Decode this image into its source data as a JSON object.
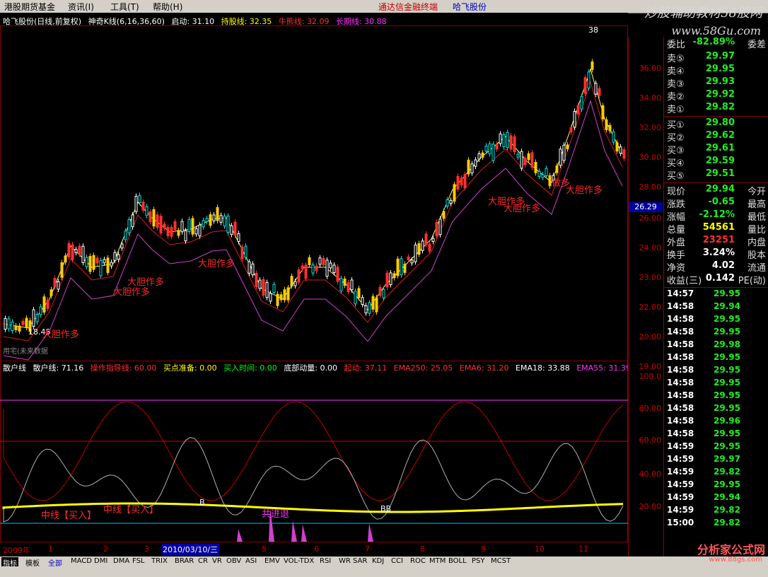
{
  "menu": {
    "items": [
      "港股期货基金",
      "资讯(I)",
      "工具(T)",
      "帮助(H)"
    ],
    "center": "通达信金融终端",
    "stock": "哈飞股份",
    "watermark": "炒股辅助教材58股网",
    "watermark_url": "www.58Gu.com"
  },
  "main_chart": {
    "info": [
      {
        "text": "哈飞股份(日线,前复权)",
        "color": "#ffffff"
      },
      {
        "text": "神奇K线(6,16,36,60)",
        "color": "#ffffff"
      },
      {
        "text": "启动: 31.10",
        "color": "#ffffff"
      },
      {
        "text": "持股线: 32.35",
        "color": "#ffff00"
      },
      {
        "text": "牛熊线: 32.09",
        "color": "#ff3030"
      },
      {
        "text": "长期线: 30.88",
        "color": "#ff30ff"
      }
    ],
    "peak_label": "38",
    "low_label": "18.45",
    "footer_text": "用宅(未来数据",
    "annotations": [
      "大胆作多",
      "大胆作多",
      "大胆作多",
      "大胆作多",
      "大胆作多",
      "大胆作多",
      "做多",
      "大胆作多"
    ],
    "y_axis": [
      "36.00",
      "34.00",
      "32.00",
      "30.00",
      "28.00",
      "26.00",
      "24.00",
      "23.00",
      "22.00",
      "20.00",
      "19.00"
    ],
    "y_highlight": "26.29"
  },
  "indicator": {
    "info": [
      {
        "text": "散户线",
        "color": "#ffffff"
      },
      {
        "text": "散户线: 71.16",
        "color": "#ffffff"
      },
      {
        "text": "操作指导线: 60.00",
        "color": "#ff3030"
      },
      {
        "text": "买点准备: 0.00",
        "color": "#ffff00"
      },
      {
        "text": "买入时间: 0.00",
        "color": "#00ff00"
      },
      {
        "text": "底部动量: 0.00",
        "color": "#ffffff"
      },
      {
        "text": "起动: 37.11",
        "color": "#ff3030"
      },
      {
        "text": "EMA250: 25.05",
        "color": "#ff3030"
      },
      {
        "text": "EMA6: 31.20",
        "color": "#ff3030"
      },
      {
        "text": "EMA18: 33.88",
        "color": "#ffffff"
      },
      {
        "text": "EMA55: 31.39",
        "color": "#ff30ff"
      }
    ],
    "y_axis": [
      "100.0",
      "80.00",
      "60.00",
      "40.00",
      "20.00"
    ],
    "annotations": [
      "中线【买入】",
      "中线【买入】",
      "共进退",
      "B",
      "BB"
    ]
  },
  "date_axis": {
    "labels": [
      "2009年",
      "1",
      "2",
      "3",
      "5",
      "6",
      "7",
      "8",
      "9",
      "10",
      "11"
    ],
    "highlight": "2010/03/10/三"
  },
  "quote": {
    "sells": [
      {
        "label": "卖⑤",
        "value": "29.97"
      },
      {
        "label": "卖④",
        "value": "29.95"
      },
      {
        "label": "卖③",
        "value": "29.93"
      },
      {
        "label": "卖②",
        "value": "29.92"
      },
      {
        "label": "卖①",
        "value": "29.82"
      }
    ],
    "buys": [
      {
        "label": "买①",
        "value": "29.80"
      },
      {
        "label": "买②",
        "value": "29.62"
      },
      {
        "label": "买③",
        "value": "29.61"
      },
      {
        "label": "买④",
        "value": "29.59"
      },
      {
        "label": "买⑤",
        "value": "29.51"
      }
    ],
    "weibi": {
      "label": "委比",
      "value": "-82.89%",
      "ext": "委差"
    },
    "stats": [
      {
        "label": "现价",
        "value": "29.94",
        "ext": "今开",
        "color": "#1ef01e"
      },
      {
        "label": "涨跌",
        "value": "-0.65",
        "ext": "最高",
        "color": "#1ef01e"
      },
      {
        "label": "涨幅",
        "value": "-2.12%",
        "ext": "最低",
        "color": "#1ef01e"
      },
      {
        "label": "总量",
        "value": "54561",
        "ext": "量比",
        "color": "#ffff00"
      },
      {
        "label": "外盘",
        "value": "23251",
        "ext": "内盘",
        "color": "#ff3030"
      },
      {
        "label": "换手",
        "value": "3.24%",
        "ext": "股本",
        "color": "#ffffff"
      },
      {
        "label": "净资",
        "value": "4.02",
        "ext": "流通",
        "color": "#ffffff"
      },
      {
        "label": "收益(三)",
        "value": "0.142",
        "ext": "PE(动)",
        "color": "#ffffff"
      }
    ]
  },
  "ticks": [
    {
      "time": "14:57",
      "price": "29.95"
    },
    {
      "time": "14:58",
      "price": "29.94"
    },
    {
      "time": "14:58",
      "price": "29.95"
    },
    {
      "time": "14:58",
      "price": "29.95"
    },
    {
      "time": "14:58",
      "price": "29.98"
    },
    {
      "time": "14:58",
      "price": "29.95"
    },
    {
      "time": "14:58",
      "price": "29.95"
    },
    {
      "time": "14:58",
      "price": "29.95"
    },
    {
      "time": "14:58",
      "price": "29.95"
    },
    {
      "time": "14:58",
      "price": "29.95"
    },
    {
      "time": "14:58",
      "price": "29.96"
    },
    {
      "time": "14:58",
      "price": "29.95"
    },
    {
      "time": "14:59",
      "price": "29.95"
    },
    {
      "time": "14:59",
      "price": "29.97"
    },
    {
      "time": "14:59",
      "price": "29.82"
    },
    {
      "time": "14:59",
      "price": "29.95"
    },
    {
      "time": "14:59",
      "price": "29.94"
    },
    {
      "time": "14:59",
      "price": "29.82"
    },
    {
      "time": "15:00",
      "price": "29.82"
    }
  ],
  "bottom_tabs": [
    "指标",
    "模板",
    "全部",
    "MACD",
    "DMI",
    "DMA",
    "FSL",
    "TRIX",
    "BRAR",
    "CR",
    "VR",
    "OBV",
    "ASI",
    "EMV",
    "VOL-TDX",
    "RSI",
    "WR",
    "SAR",
    "KDJ",
    "CCI",
    "ROC",
    "MTM",
    "BOLL",
    "PSY",
    "MCST"
  ],
  "logo": {
    "text": "分析家公式网",
    "url": "www.88gs.com"
  }
}
